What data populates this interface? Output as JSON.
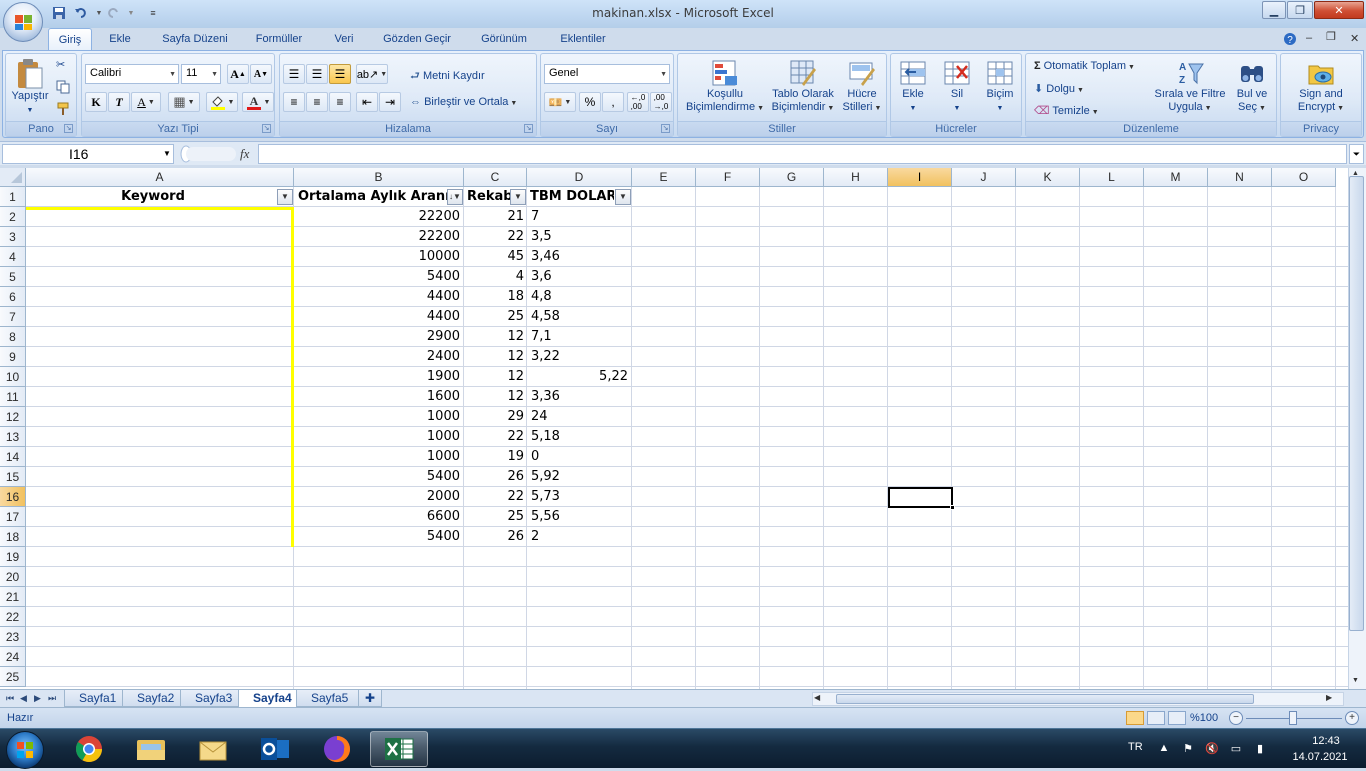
{
  "window": {
    "title": "makinan.xlsx - Microsoft Excel",
    "minimize": "▁",
    "maximize": "❐",
    "close": "✕"
  },
  "ribbon_tabs": [
    "Giriş",
    "Ekle",
    "Sayfa Düzeni",
    "Formüller",
    "Veri",
    "Gözden Geçir",
    "Görünüm",
    "Eklentiler"
  ],
  "ribbon": {
    "pano": {
      "label": "Pano",
      "paste": "Yapıştır"
    },
    "yazi_tipi": {
      "label": "Yazı Tipi",
      "font": "Calibri",
      "size": "11",
      "bold": "K",
      "italic": "T",
      "underline": "A"
    },
    "hizalama": {
      "label": "Hizalama",
      "wrap": "Metni Kaydır",
      "merge": "Birleştir ve Ortala"
    },
    "sayi": {
      "label": "Sayı",
      "format": "Genel",
      "percent": "%",
      "comma": ","
    },
    "stiller": {
      "label": "Stiller",
      "conditional": "Koşullu\nBiçimlendirme",
      "table": "Tablo Olarak\nBiçimlendir",
      "cell_styles": "Hücre\nStilleri"
    },
    "hucreler": {
      "label": "Hücreler",
      "insert": "Ekle",
      "delete": "Sil",
      "format": "Biçim"
    },
    "duzenleme": {
      "label": "Düzenleme",
      "autosum": "Otomatik Toplam",
      "fill": "Dolgu",
      "clear": "Temizle",
      "sort": "Sırala ve Filtre\nUygula",
      "find": "Bul ve\nSeç"
    },
    "privacy": {
      "label": "Privacy",
      "sign": "Sign and\nEncrypt"
    }
  },
  "formula_bar": {
    "name_box": "I16",
    "fx": "fx",
    "formula": ""
  },
  "columns": [
    "A",
    "B",
    "C",
    "D",
    "E",
    "F",
    "G",
    "H",
    "I",
    "J",
    "K",
    "L",
    "M",
    "N",
    "O"
  ],
  "selected_column": "I",
  "rows": [
    "1",
    "2",
    "3",
    "4",
    "5",
    "6",
    "7",
    "8",
    "9",
    "10",
    "11",
    "12",
    "13",
    "14",
    "15",
    "16",
    "17",
    "18",
    "19",
    "20",
    "21",
    "22",
    "23",
    "24",
    "25"
  ],
  "selected_row": "16",
  "table": {
    "headers": {
      "a": "Keyword",
      "b": "Ortalama Aylık Arann",
      "c": "Rekab",
      "d": "TBM DOLAR"
    },
    "data": [
      {
        "b": "22200",
        "c": "21",
        "d": "7"
      },
      {
        "b": "22200",
        "c": "22",
        "d": "3,5"
      },
      {
        "b": "10000",
        "c": "45",
        "d": "3,46"
      },
      {
        "b": "5400",
        "c": "4",
        "d": "3,6"
      },
      {
        "b": "4400",
        "c": "18",
        "d": "4,8"
      },
      {
        "b": "4400",
        "c": "25",
        "d": "4,58"
      },
      {
        "b": "2900",
        "c": "12",
        "d": "7,1"
      },
      {
        "b": "2400",
        "c": "12",
        "d": "3,22"
      },
      {
        "b": "1900",
        "c": "12",
        "d": "5,22",
        "d_right": true
      },
      {
        "b": "1600",
        "c": "12",
        "d": "3,36"
      },
      {
        "b": "1000",
        "c": "29",
        "d": "24"
      },
      {
        "b": "1000",
        "c": "22",
        "d": "5,18"
      },
      {
        "b": "1000",
        "c": "19",
        "d": "0"
      },
      {
        "b": "5400",
        "c": "26",
        "d": "5,92"
      },
      {
        "b": "2000",
        "c": "22",
        "d": "5,73"
      },
      {
        "b": "6600",
        "c": "25",
        "d": "5,56"
      },
      {
        "b": "5400",
        "c": "26",
        "d": "2"
      }
    ]
  },
  "sheet_tabs": [
    "Sayfa1",
    "Sayfa2",
    "Sayfa3",
    "Sayfa4",
    "Sayfa5"
  ],
  "active_sheet": "Sayfa4",
  "status": {
    "text": "Hazır",
    "zoom": "%100"
  },
  "taskbar": {
    "lang": "TR",
    "time": "12:43",
    "date": "14.07.2021"
  },
  "colors": {
    "highlight": "#ffff00",
    "ribbon_text": "#15428b",
    "selected_header": "#f1c15f"
  }
}
